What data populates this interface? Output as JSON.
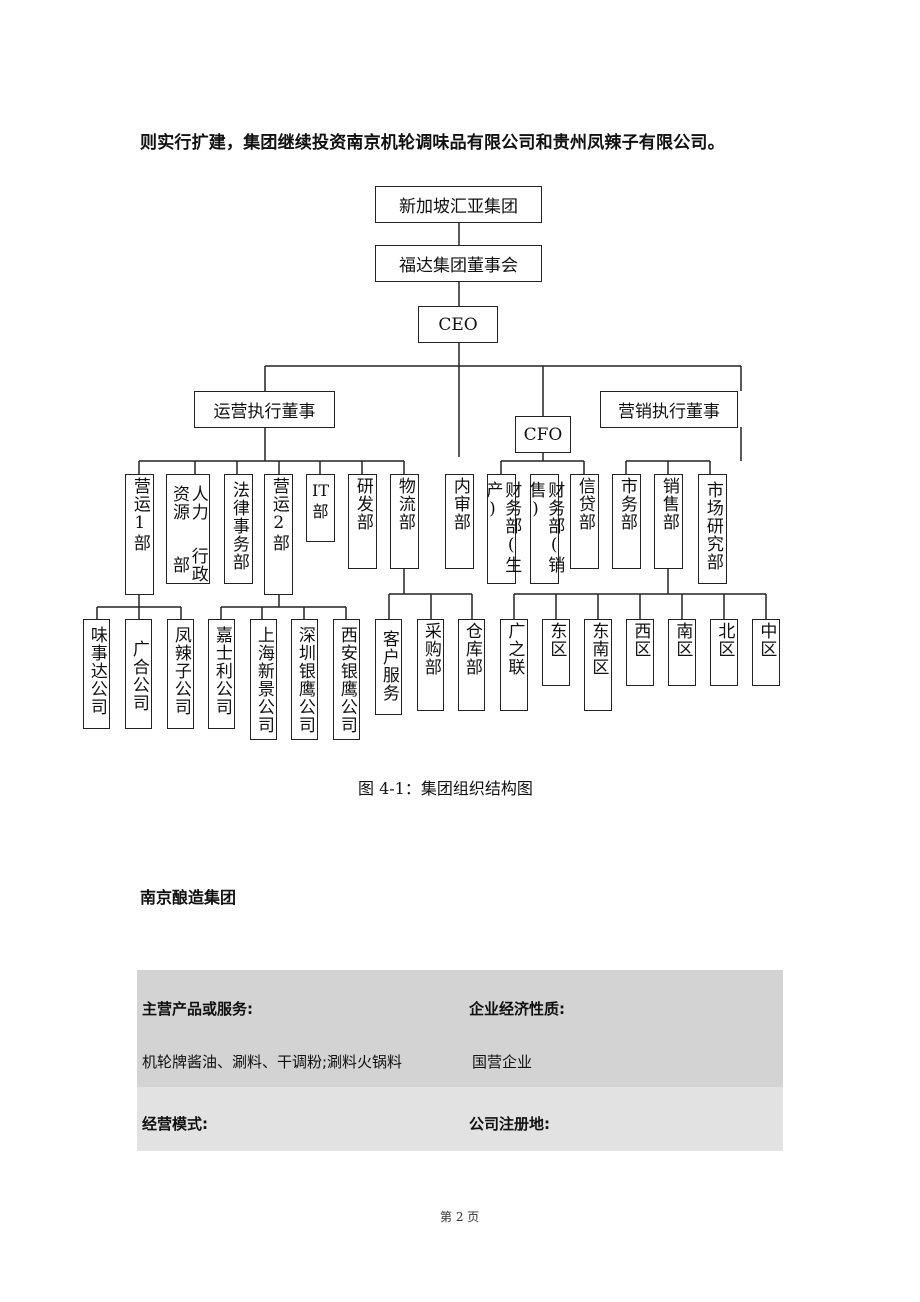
{
  "intro_text": "则实行扩建，集团继续投资南京机轮调味品有限公司和贵州凤辣子有限公司。",
  "org_chart": {
    "root": "新加坡汇亚集团",
    "board": "福达集团董事会",
    "ceo": "CEO",
    "ops_director": "运营执行董事",
    "cfo": "CFO",
    "marketing_director": "营销执行董事",
    "internal_audit": "内审部",
    "ops_departments": [
      "营运1部",
      "人力资源行政部",
      "法律事务部",
      "营运2部",
      "IT部",
      "研发部",
      "物流部"
    ],
    "hr_lines": [
      "人力资源",
      "行政部"
    ],
    "finance_departments": [
      "财务部(生产)",
      "财务部(销售)",
      "信贷部"
    ],
    "marketing_departments": [
      "市务部",
      "销售部",
      "市场研究部"
    ],
    "ops1_subsidiaries": [
      "味事达公司",
      "广合公司",
      "凤辣子公司"
    ],
    "ops2_subsidiaries": [
      "嘉士利公司",
      "上海新景公司",
      "深圳银鹰公司",
      "西安银鹰公司"
    ],
    "logistics_units": [
      "客户服务",
      "采购部",
      "仓库部"
    ],
    "sales_regions": [
      "广之联",
      "东区",
      "东南区",
      "西区",
      "南区",
      "北区",
      "中区"
    ]
  },
  "caption": "图 4-1：集团组织结构图",
  "section_title": "南京酿造集团",
  "info_table": {
    "products_label": "主营产品或服务:",
    "products_value": "机轮牌酱油、涮料、干调粉;涮料火锅料",
    "nature_label": "企业经济性质:",
    "nature_value": "国营企业",
    "mode_label": "经营模式:",
    "reg_label": "公司注册地:"
  },
  "footer": "第 2 页"
}
